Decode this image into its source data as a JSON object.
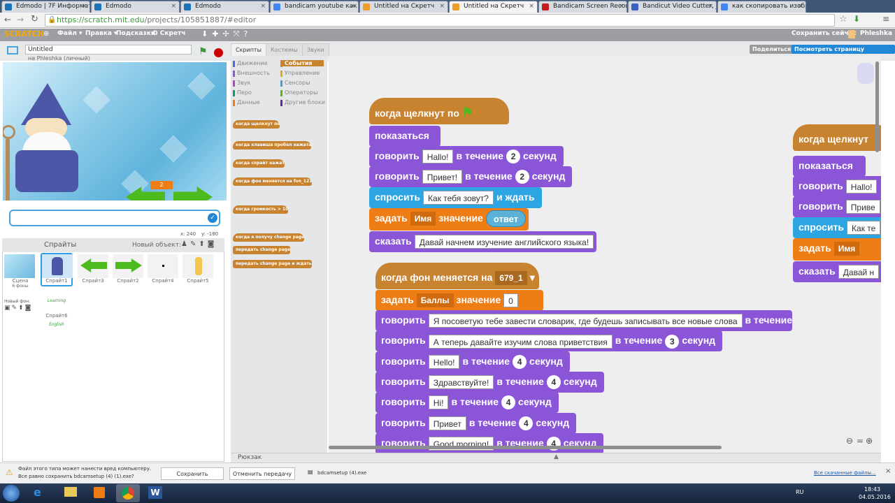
{
  "browser": {
    "tabs": [
      {
        "label": "Edmodo | 7F Информати",
        "color": "#1a73b8"
      },
      {
        "label": "Edmodo",
        "color": "#1a73b8"
      },
      {
        "label": "Edmodo",
        "color": "#1a73b8"
      },
      {
        "label": "bandicam youtube как пс",
        "color": "#4285f4"
      },
      {
        "label": "Untitled на Скретч",
        "color": "#ee9c2a"
      },
      {
        "label": "Untitled на Скретч",
        "color": "#ee9c2a"
      },
      {
        "label": "Bandicam Screen Recorde",
        "color": "#c61b1b"
      },
      {
        "label": "Bandicut Video Cutter, Jo",
        "color": "#3960c4"
      },
      {
        "label": "как скопировать изобра",
        "color": "#4285f4"
      }
    ],
    "url_host": "https://scratch.mit.edu",
    "url_path": "/projects/105851887/#editor"
  },
  "menubar": {
    "logo": "SCRATCH",
    "items": [
      "Файл ▾",
      "Правка ▾",
      "Подсказки",
      "О Скретч"
    ],
    "save_now": "Сохранить сейчас",
    "user": "Phleshka"
  },
  "project": {
    "title": "Untitled",
    "owner": "на Phleshka (личный)",
    "share": "Поделиться",
    "see_project": "Посмотреть страницу проекта"
  },
  "stage": {
    "counter": "2",
    "coords_x": "x: 240",
    "coords_y": "y: -180"
  },
  "sprites": {
    "header": "Спрайты",
    "new_object": "Новый объект:",
    "scene": "Сцена",
    "scene_count": "6 фоны",
    "new_bg": "Новый фон:",
    "items": [
      "Спрайт1",
      "Спрайт3",
      "Спрайт2",
      "Спрайт4",
      "Спрайт5",
      "Спрайт6"
    ],
    "sprite6_text": "Learning English"
  },
  "palette": {
    "tabs": [
      "Скрипты",
      "Костюмы",
      "Звуки"
    ],
    "categories_left": [
      {
        "label": "Движение",
        "color": "#4a6cd4"
      },
      {
        "label": "Внешность",
        "color": "#8a55d7"
      },
      {
        "label": "Звук",
        "color": "#bb42c3"
      },
      {
        "label": "Перо",
        "color": "#0e9a6c"
      },
      {
        "label": "Данные",
        "color": "#ee7d16"
      }
    ],
    "categories_right": [
      {
        "label": "События",
        "color": "#c88330"
      },
      {
        "label": "Управление",
        "color": "#e1a91a"
      },
      {
        "label": "Сенсоры",
        "color": "#2ca5e2"
      },
      {
        "label": "Операторы",
        "color": "#5cb712"
      },
      {
        "label": "Другие блоки",
        "color": "#632d99"
      }
    ],
    "blocks": [
      "когда щелкнут по",
      "когда клавиша пробел нажата",
      "когда спрайт нажат",
      "когда фон меняется на fon_121",
      "когда громкость > 10",
      "когда я получу change page",
      "передать change page",
      "передать change page и ждать"
    ]
  },
  "script1": {
    "hat": "когда щелкнут по",
    "show": "показаться",
    "say1": {
      "kw": "говорить",
      "text": "Hallo!",
      "mid": "в течение",
      "secs": "2",
      "unit": "секунд"
    },
    "say2": {
      "kw": "говорить",
      "text": "Привет!",
      "mid": "в течение",
      "secs": "2",
      "unit": "секунд"
    },
    "ask": {
      "kw": "спросить",
      "text": "Как тебя зовут?",
      "tail": "и ждать"
    },
    "set": {
      "kw": "задать",
      "var": "Имя",
      "mid": "значение",
      "val": "ответ"
    },
    "speak": {
      "kw": "сказать",
      "text": "Давай начнем изучение английского языка!"
    }
  },
  "script2": {
    "hat": "когда фон меняется на",
    "backdrop": "679_1",
    "set": {
      "kw": "задать",
      "var": "Баллы",
      "mid": "значение",
      "val": "0"
    },
    "says": [
      {
        "text": "Я посоветую тебе завести словарик, где будешь записывать все новые слова",
        "secs": ""
      },
      {
        "text": "А теперь давайте изучим слова приветствия",
        "secs": "3"
      },
      {
        "text": "Hello!",
        "secs": "4"
      },
      {
        "text": "Здравствуйте!",
        "secs": "4"
      },
      {
        "text": "Hi!",
        "secs": "4"
      },
      {
        "text": "Привет",
        "secs": "4"
      },
      {
        "text": "Good morning!",
        "secs": "4"
      }
    ],
    "kw": "говорить",
    "mid": "в течение",
    "unit": "секунд"
  },
  "script3": {
    "hat": "когда щелкнут",
    "show": "показаться",
    "say1": "Hallo!",
    "say2": "Приве",
    "ask": "Как те",
    "set_var": "Имя",
    "speak": "Давай н"
  },
  "backpack": "Рюкзак",
  "download": {
    "warning1": "Файл этого типа может нанести вред компьютеру.",
    "warning2": "Все равно сохранить bdcamsetup (4) (1).exe?",
    "save": "Сохранить",
    "cancel": "Отменить передачу",
    "file": "bdcamsetup (4).exe",
    "all": "Все скачанные файлы..."
  },
  "taskbar": {
    "lang": "RU",
    "time": "18:43",
    "date": "04.05.2016"
  }
}
